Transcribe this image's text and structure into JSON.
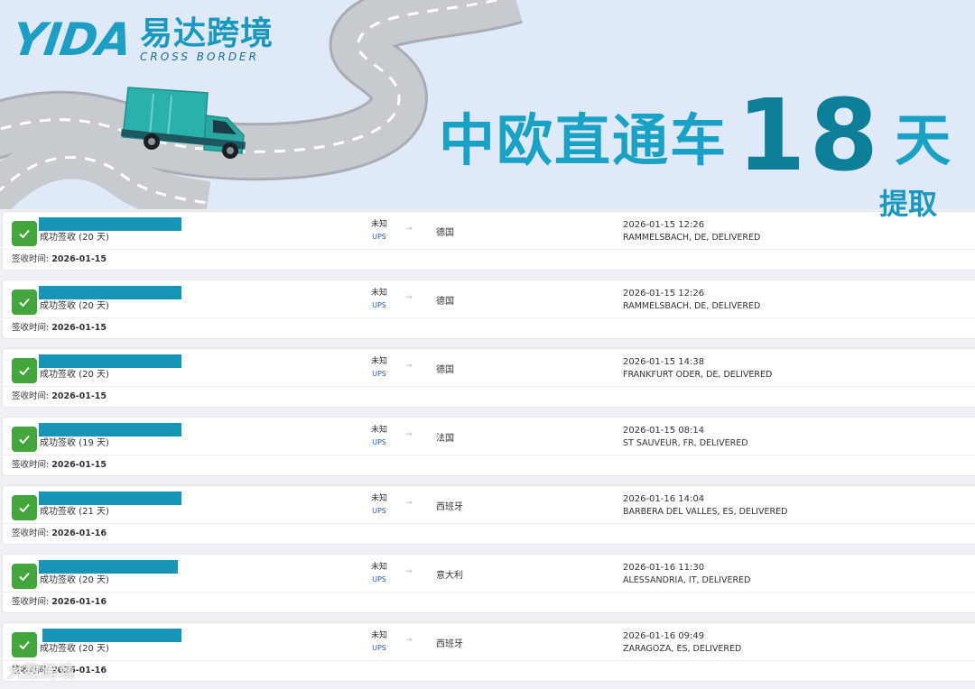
{
  "banner": {
    "logo_latin": "YIDA",
    "logo_cn": "易达跨境",
    "logo_en": "CROSS BORDER",
    "headline_a": "中欧直通车",
    "headline_num": "18",
    "headline_b": "天",
    "headline_sub": "提取",
    "truck_icon": "truck-icon",
    "road_icon": "winding-road"
  },
  "colors": {
    "brand_blue": "#1aa1c6",
    "banner_bg": "#dfe9f8",
    "success_green": "#43a63c",
    "carrier_blue": "#2b55c2",
    "redaction": "#1795b9"
  },
  "shipments": [
    {
      "status": "成功签收 (20 天)",
      "carrier_status": "未知",
      "carrier": "UPS",
      "arrow": "→",
      "destination": "德国",
      "event_time": "2026-01-15 12:26",
      "event_location": "RAMMELSBACH, DE, DELIVERED",
      "signed_label": "签收时间:",
      "signed_date": "2026-01-15"
    },
    {
      "status": "成功签收 (20 天)",
      "carrier_status": "未知",
      "carrier": "UPS",
      "arrow": "→",
      "destination": "德国",
      "event_time": "2026-01-15 12:26",
      "event_location": "RAMMELSBACH, DE, DELIVERED",
      "signed_label": "签收时间:",
      "signed_date": "2026-01-15"
    },
    {
      "status": "成功签收 (20 天)",
      "carrier_status": "未知",
      "carrier": "UPS",
      "arrow": "→",
      "destination": "德国",
      "event_time": "2026-01-15 14:38",
      "event_location": "FRANKFURT ODER, DE, DELIVERED",
      "signed_label": "签收时间:",
      "signed_date": "2026-01-15"
    },
    {
      "status": "成功签收 (19 天)",
      "carrier_status": "未知",
      "carrier": "UPS",
      "arrow": "→",
      "destination": "法国",
      "event_time": "2026-01-15 08:14",
      "event_location": "ST SAUVEUR, FR, DELIVERED",
      "signed_label": "签收时间:",
      "signed_date": "2026-01-15"
    },
    {
      "status": "成功签收 (21 天)",
      "carrier_status": "未知",
      "carrier": "UPS",
      "arrow": "→",
      "destination": "西班牙",
      "event_time": "2026-01-16 14:04",
      "event_location": "BARBERA DEL VALLES, ES, DELIVERED",
      "signed_label": "签收时间:",
      "signed_date": "2026-01-16"
    },
    {
      "status": "成功签收 (20 天)",
      "carrier_status": "未知",
      "carrier": "UPS",
      "arrow": "→",
      "destination": "意大利",
      "event_time": "2026-01-16 11:30",
      "event_location": "ALESSANDRIA, IT, DELIVERED",
      "signed_label": "签收时间:",
      "signed_date": "2026-01-16"
    },
    {
      "status": "成功签收 (20 天)",
      "carrier_status": "未知",
      "carrier": "UPS",
      "arrow": "→",
      "destination": "西班牙",
      "event_time": "2026-01-16 09:49",
      "event_location": "ZARAGOZA, ES, DELIVERED",
      "signed_label": "签收时间:",
      "signed_date": "2026-01-16"
    }
  ],
  "watermark": "大数跨境"
}
